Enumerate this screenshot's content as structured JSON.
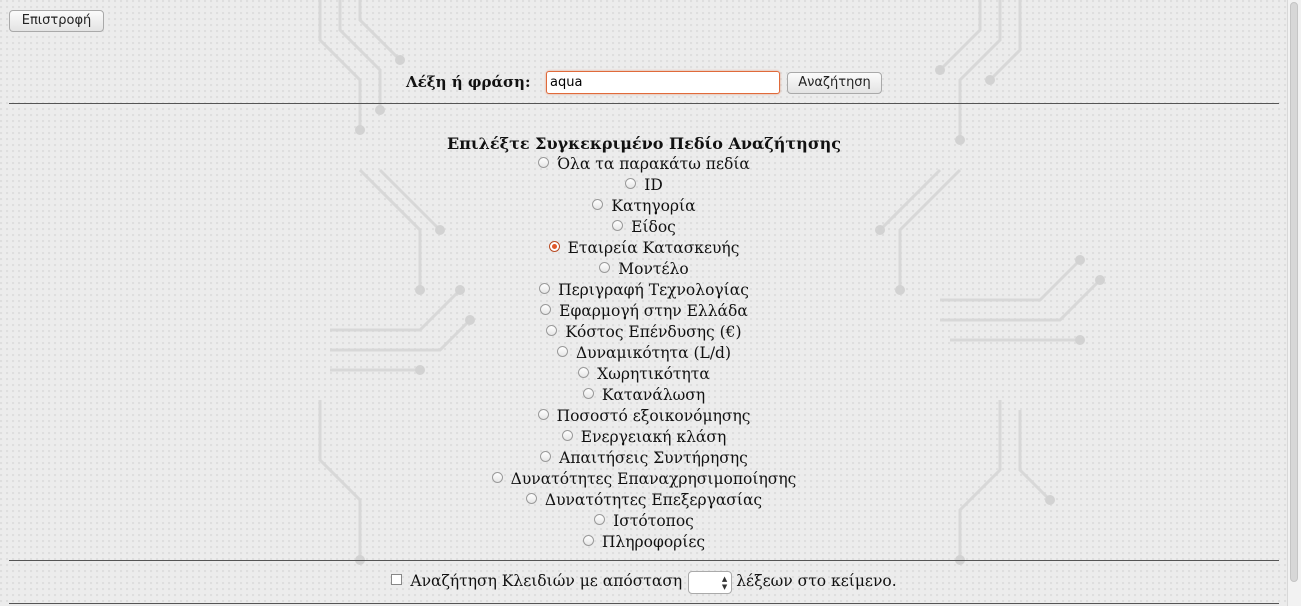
{
  "nav": {
    "back_label": "Επιστροφή"
  },
  "search": {
    "label": "Λέξη ή φράση:",
    "value": "aqua",
    "button_label": "Αναζήτηση"
  },
  "fields": {
    "title": "Επιλέξτε Συγκεκριμένο Πεδίο Αναζήτησης",
    "selected": "Εταιρεία Κατασκευής",
    "options": [
      "Όλα τα παρακάτω πεδία",
      "ID",
      "Κατηγορία",
      "Είδος",
      "Εταιρεία Κατασκευής",
      "Μοντέλο",
      "Περιγραφή Τεχνολογίας",
      "Εφαρμογή στην Ελλάδα",
      "Κόστος Επένδυσης (€)",
      "Δυναμικότητα (L/d)",
      "Χωρητικότητα",
      "Κατανάλωση",
      "Ποσοστό εξοικονόμησης",
      "Ενεργειακή κλάση",
      "Απαιτήσεις Συντήρησης",
      "Δυνατότητες Επαναχρησιμοποίησης",
      "Δυνατότητες Επεξεργασίας",
      "Ιστότοπος",
      "Πληροφορίες"
    ]
  },
  "proximity": {
    "label_before": "Αναζήτηση Κλειδιών με απόσταση",
    "label_after": "λέξεων στο κείμενο.",
    "checked": false,
    "distance_value": ""
  },
  "colors": {
    "accent": "#e0582a",
    "background": "#ececec"
  },
  "icons": {
    "spinner_up": "chevron-up-icon",
    "spinner_down": "chevron-down-icon"
  }
}
